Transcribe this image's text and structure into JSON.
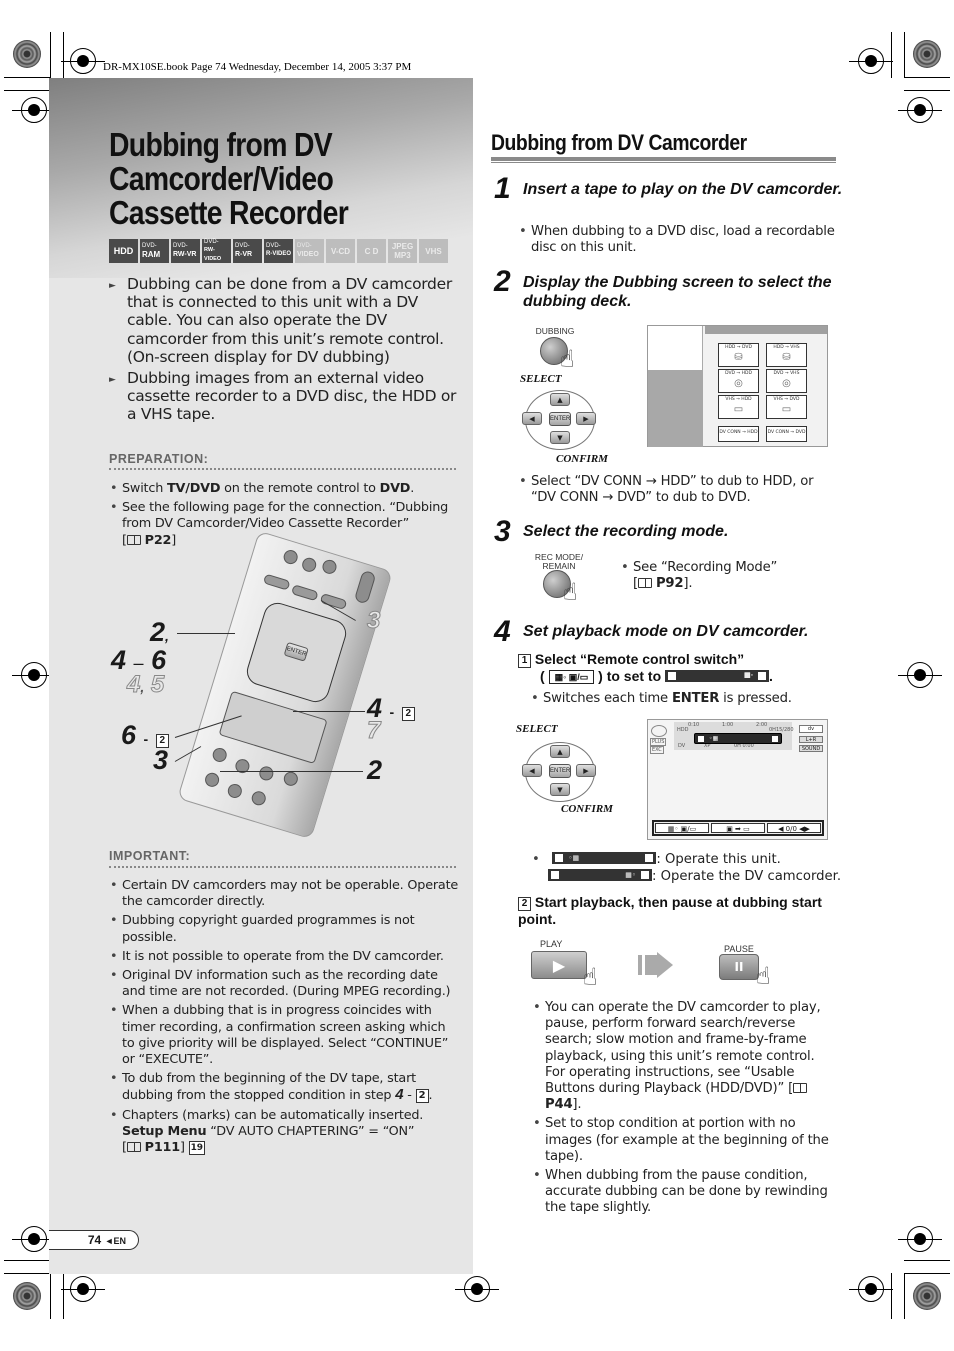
{
  "book_header": "DR-MX10SE.book  Page 74  Wednesday, December 14, 2005  3:37 PM",
  "left": {
    "title_lines": [
      "Dubbing from DV",
      "Camcorder/Video",
      "Cassette Recorder"
    ],
    "media_badges": [
      {
        "top": "",
        "main": "HDD",
        "active": true
      },
      {
        "top": "DVD-",
        "main": "RAM",
        "active": true
      },
      {
        "top": "DVD-",
        "main": "RW-VR",
        "active": true
      },
      {
        "top": "DVD-",
        "main": "RW-VIDEO",
        "active": true
      },
      {
        "top": "DVD-",
        "main": "R-VR",
        "active": true
      },
      {
        "top": "DVD-",
        "main": "R-VIDEO",
        "active": true
      },
      {
        "top": "DVD-",
        "main": "VIDEO",
        "active": false
      },
      {
        "top": "",
        "main": "V-CD",
        "active": false
      },
      {
        "top": "",
        "main": "C D",
        "active": false
      },
      {
        "top": "JPEG",
        "main": "MP3",
        "active": false
      },
      {
        "top": "",
        "main": "VHS",
        "active": false
      }
    ],
    "intro": [
      "Dubbing can be done from a DV camcorder that is connected to this unit with a DV cable. You can also operate the DV camcorder from this unit’s remote control. (On-screen display for DV dubbing)",
      "Dubbing images from an external video cassette recorder to a DVD disc, the HDD or a VHS tape."
    ],
    "preparation": {
      "label": "PREPARATION:",
      "item1": {
        "pre": "Switch ",
        "b1": "TV/DVD",
        "mid": " on the remote control to ",
        "b2": "DVD",
        "post": "."
      },
      "item2": {
        "text": "See the following page for the connection. “Dubbing from DV Camcorder/Video Cassette Recorder”",
        "ref": "P22"
      }
    },
    "remote_callouts": {
      "c1": "2",
      "c1_sep": ",",
      "c2a": "4",
      "c2_sep": "–",
      "c2b": "6",
      "c3a": "4",
      "c3_sep": ",",
      "c3b": "5",
      "c4": "6",
      "c4_dash": "-",
      "c4_box": "2",
      "c5": "3",
      "r1": "3",
      "r2": "4",
      "r2_dash": "-",
      "r2_box": "2",
      "r3": "7",
      "r4": "2"
    },
    "important": {
      "label": "IMPORTANT:",
      "items": [
        "Certain DV camcorders may not be operable. Operate the camcorder directly.",
        "Dubbing copyright guarded programmes is not possible.",
        "It is not possible to operate from the DV camcorder.",
        "Original DV information such as the recording date and time are not recorded. (During MPEG recording.)",
        "When a dubbing that is in progress coincides with timer recording, a confirmation screen asking which to give priority will be displayed. Select “CONTINUE” or “EXECUTE”."
      ],
      "item6": {
        "text": "To dub from the beginning of the DV tape, start dubbing from the stopped condition in step",
        "step": "4",
        "dash": "-",
        "box": "2",
        "end": "."
      },
      "item7": {
        "text": "Chapters (marks) can be automatically inserted.",
        "b": "Setup Menu",
        "rest": " “DV AUTO CHAPTERING” = “ON”",
        "ref": "P111",
        "box": "19"
      }
    },
    "page_number": "74",
    "page_arrow": "◄",
    "page_lang": "EN"
  },
  "right": {
    "title": "Dubbing from DV Camcorder",
    "step1": {
      "num": "1",
      "title": "Insert a tape to play on the DV camcorder.",
      "bullet": "When dubbing to a DVD disc, load a recordable disc on this unit."
    },
    "step2": {
      "num": "2",
      "title": "Display the Dubbing screen to select the dubbing deck.",
      "button_label": "DUBBING",
      "select": "SELECT",
      "confirm": "CONFIRM",
      "enter": "ENTER",
      "cells": [
        {
          "label": "HDD → DVD",
          "glyph": "⛁"
        },
        {
          "label": "HDD → VHS",
          "glyph": "⛁"
        },
        {
          "label": "DVD → HDD",
          "glyph": "◎"
        },
        {
          "label": "DVD → VHS",
          "glyph": "◎"
        },
        {
          "label": "VHS → HDD",
          "glyph": "▭"
        },
        {
          "label": "VHS → DVD",
          "glyph": "▭"
        },
        {
          "label": "DV CONN → HDD",
          "glyph": ""
        },
        {
          "label": "DV CONN → DVD",
          "glyph": ""
        }
      ],
      "bullet": "Select “DV CONN → HDD” to dub to HDD, or “DV CONN → DVD” to dub to DVD."
    },
    "step3": {
      "num": "3",
      "title": "Select the recording mode.",
      "button_label_1": "REC MODE/",
      "button_label_2": "REMAIN",
      "bullet": "See “Recording Mode”",
      "ref": "P92"
    },
    "step4": {
      "num": "4",
      "title": "Set playback mode on DV camcorder.",
      "sub1": {
        "box": "1",
        "text1": "Select “Remote control switch”",
        "text2a": "(",
        "icon": "▦◦ ▣/▭",
        "text2b": ") to set to",
        "text2c": "."
      },
      "sub1_bullet": {
        "pre": "Switches each time ",
        "b": "ENTER",
        "post": " is pressed."
      },
      "select": "SELECT",
      "confirm": "CONFIRM",
      "enter": "ENTER",
      "screen": {
        "t1": "0:10",
        "t2": "1:00",
        "t3": "2:00",
        "hdd": "HDD",
        "remain": "0H15/280",
        "mode": "PLUS",
        "rec": "EXC",
        "dv": "DV",
        "xp": "XP",
        "date": "0H 0:00",
        "right1": "dv",
        "right2": "L+R",
        "right3": "SOUND",
        "b1": "▦◦ ▣/▭",
        "b2": "▣ ➡ ▭",
        "b3": "◀ 0/0 ◀▶"
      },
      "legend1": ": Operate this unit.",
      "legend2": ": Operate the DV camcorder.",
      "sub2": {
        "box": "2",
        "text": "Start playback, then pause at dubbing start point."
      },
      "play_label": "PLAY",
      "pause_label": "PAUSE",
      "bullets": [
        {
          "text": "You can operate the DV camcorder to play, pause, perform forward search/reverse search; slow motion and frame-by-frame playback, using this unit’s remote control.",
          "text2": "For operating instructions, see “Usable Buttons during Playback (HDD/DVD)”",
          "ref": "P44"
        },
        {
          "text": "Set to stop condition at portion with no images (for example at the beginning of the tape)."
        },
        {
          "text": "When dubbing from the pause condition, accurate dubbing can be done by rewinding the tape slightly."
        }
      ]
    }
  }
}
